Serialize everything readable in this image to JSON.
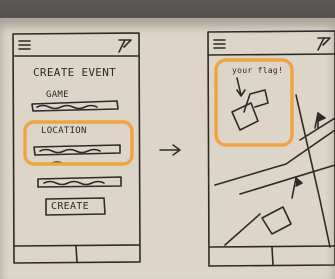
{
  "left_sketch": {
    "title": "CREATE EVENT",
    "fields": [
      {
        "label": "GAME"
      },
      {
        "label": "LOCATION"
      },
      {
        "label": ""
      }
    ],
    "button_label": "CREATE"
  },
  "right_sketch": {
    "annotation": "your flag!"
  },
  "colors": {
    "ink": "#2d2a27",
    "highlight": "#f0a341",
    "paper": "#ddd6c8",
    "backdrop": "#4a4744"
  }
}
